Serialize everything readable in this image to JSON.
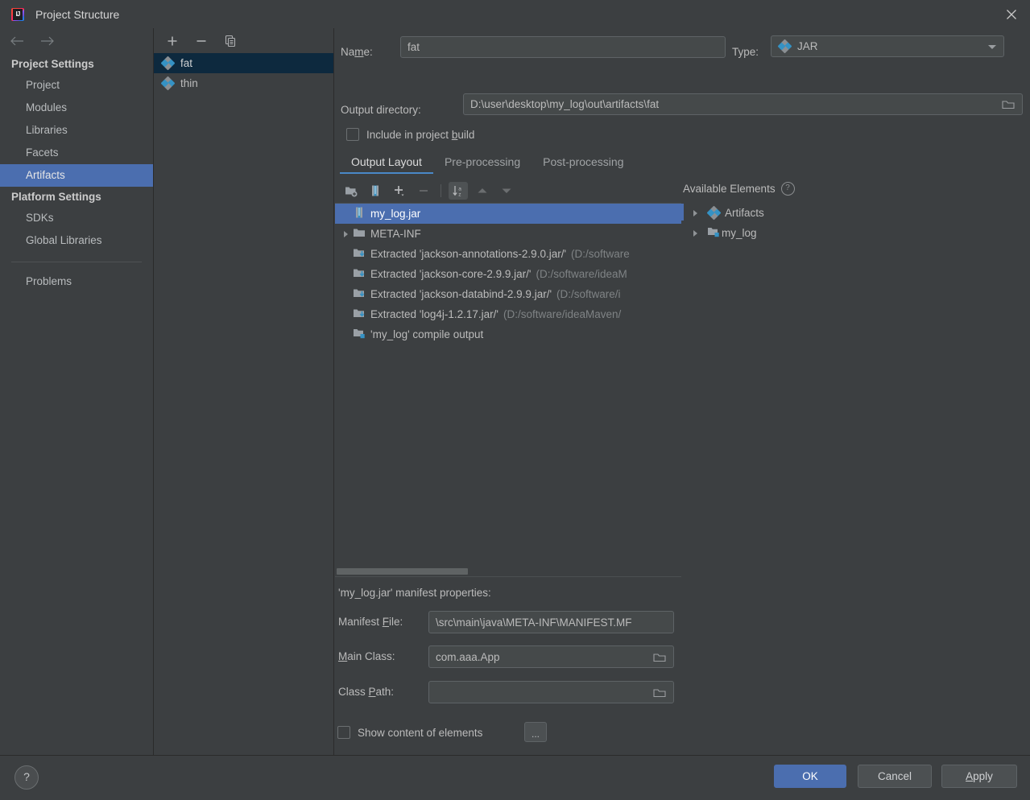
{
  "window": {
    "title": "Project Structure",
    "app_icon": "intellij-idea-icon",
    "close_icon": "close-icon"
  },
  "sidebar": {
    "back_icon": "arrow-left-icon",
    "forward_icon": "arrow-right-icon",
    "groups": [
      {
        "header": "Project Settings",
        "items": [
          {
            "label": "Project",
            "selected": false
          },
          {
            "label": "Modules",
            "selected": false
          },
          {
            "label": "Libraries",
            "selected": false
          },
          {
            "label": "Facets",
            "selected": false
          },
          {
            "label": "Artifacts",
            "selected": true
          }
        ]
      },
      {
        "header": "Platform Settings",
        "items": [
          {
            "label": "SDKs",
            "selected": false
          },
          {
            "label": "Global Libraries",
            "selected": false
          }
        ]
      }
    ],
    "problems": "Problems"
  },
  "artifacts_panel": {
    "toolbar": [
      {
        "name": "add-artifact-button",
        "glyph": "+"
      },
      {
        "name": "remove-artifact-button",
        "glyph": "−"
      },
      {
        "name": "copy-artifact-button",
        "glyph": "copy-icon"
      }
    ],
    "items": [
      {
        "label": "fat",
        "icon": "artifact-icon",
        "selected": true
      },
      {
        "label": "thin",
        "icon": "artifact-icon",
        "selected": false
      }
    ]
  },
  "details": {
    "name_label": "Name:",
    "name_mnemonic": "m",
    "name_value": "fat",
    "type_label": "Type:",
    "type_value": "JAR",
    "type_icon": "artifact-icon",
    "output_dir_label": "Output directory:",
    "output_dir_value": "D:\\user\\desktop\\my_log\\out\\artifacts\\fat",
    "include_in_build_label": "Include in project build",
    "include_in_build_checked": false,
    "tabs": [
      {
        "label": "Output Layout",
        "active": true
      },
      {
        "label": "Pre-processing",
        "active": false
      },
      {
        "label": "Post-processing",
        "active": false
      }
    ]
  },
  "layout_toolbar": [
    {
      "name": "add-directory-button",
      "icon": "folder-add-icon",
      "state": "enabled"
    },
    {
      "name": "add-archive-button",
      "icon": "jar-icon",
      "state": "enabled"
    },
    {
      "name": "add-copy-button",
      "icon": "plus-dropdown-icon",
      "state": "enabled"
    },
    {
      "name": "remove-element-button",
      "icon": "minus-icon",
      "state": "disabled"
    },
    {
      "name": "sort-button",
      "icon": "sort-az-icon",
      "state": "pressed"
    },
    {
      "name": "move-up-button",
      "icon": "arrow-up-icon",
      "state": "disabled"
    },
    {
      "name": "move-down-button",
      "icon": "arrow-down-icon",
      "state": "disabled"
    }
  ],
  "output_tree": [
    {
      "label": "my_log.jar",
      "path": "",
      "icon": "jar-icon",
      "indent": 0,
      "twisty": "none",
      "selected": true
    },
    {
      "label": "META-INF",
      "path": "",
      "icon": "folder-icon",
      "indent": 0,
      "twisty": "collapsed",
      "selected": false
    },
    {
      "label": "Extracted 'jackson-annotations-2.9.0.jar/'",
      "path": "(D:/software",
      "icon": "extracted-icon",
      "indent": 0,
      "twisty": "none",
      "selected": false
    },
    {
      "label": "Extracted 'jackson-core-2.9.9.jar/'",
      "path": "(D:/software/ideaM",
      "icon": "extracted-icon",
      "indent": 0,
      "twisty": "none",
      "selected": false
    },
    {
      "label": "Extracted 'jackson-databind-2.9.9.jar/'",
      "path": "(D:/software/i",
      "icon": "extracted-icon",
      "indent": 0,
      "twisty": "none",
      "selected": false
    },
    {
      "label": "Extracted 'log4j-1.2.17.jar/'",
      "path": "(D:/software/ideaMaven/",
      "icon": "extracted-icon",
      "indent": 0,
      "twisty": "none",
      "selected": false
    },
    {
      "label": "'my_log' compile output",
      "path": "",
      "icon": "compile-output-icon",
      "indent": 0,
      "twisty": "none",
      "selected": false
    }
  ],
  "available_elements": {
    "title": "Available Elements",
    "help_icon": "help-icon",
    "items": [
      {
        "label": "Artifacts",
        "icon": "artifact-icon",
        "twisty": "collapsed"
      },
      {
        "label": "my_log",
        "icon": "module-icon",
        "twisty": "collapsed"
      }
    ]
  },
  "manifest": {
    "title": "'my_log.jar' manifest properties:",
    "manifest_file_label": "Manifest File:",
    "manifest_file_mnemonic": "F",
    "manifest_file_value": "\\src\\main\\java\\META-INF\\MANIFEST.MF",
    "main_class_label": "Main Class:",
    "main_class_mnemonic": "M",
    "main_class_value": "com.aaa.App",
    "class_path_label": "Class Path:",
    "class_path_mnemonic": "P",
    "class_path_value": "",
    "show_content_label": "Show content of elements",
    "show_content_checked": false,
    "ellipsis_button": "..."
  },
  "footer": {
    "help_icon": "?",
    "ok": "OK",
    "cancel": "Cancel",
    "apply": "Apply",
    "apply_mnemonic": "A"
  },
  "colors": {
    "background": "#3c3f41",
    "selection_focused": "#4b6eaf",
    "selection_unfocused": "#0d293e",
    "accent": "#4a88c7",
    "icon_blue": "#3592c4",
    "text": "#bbbbbb",
    "muted_text": "#7f8385"
  }
}
